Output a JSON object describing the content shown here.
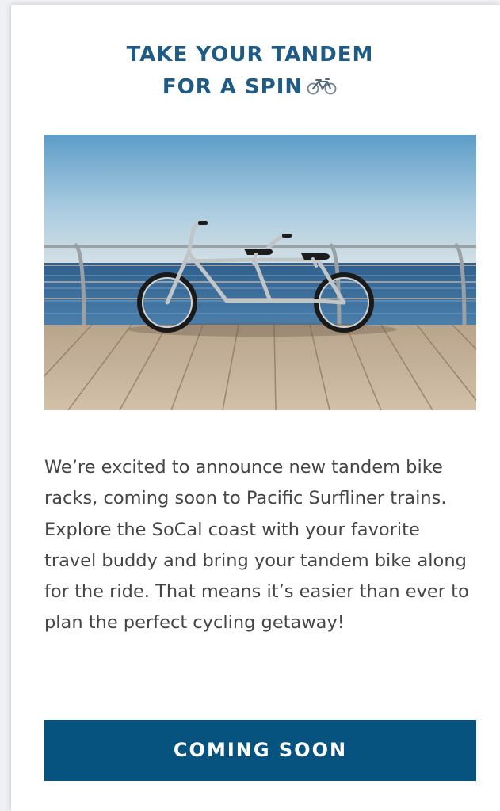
{
  "promo": {
    "title_line1": "TAKE YOUR TANDEM",
    "title_line2": "FOR A SPIN",
    "title_icon": "bicycle-icon",
    "image_subject": "tandem-bicycle-on-boardwalk",
    "body": "We’re excited to announce new tandem bike racks, coming soon to Pacific Surfliner trains. Explore the SoCal coast with your favorite travel buddy and bring your tandem bike along for the ride. That means it’s easier than ever to plan the perfect cycling getaway!",
    "cta_label": "COMING SOON"
  },
  "colors": {
    "title": "#1e5b86",
    "text": "#454545",
    "button": "#05537e",
    "button_text": "#ffffff",
    "background": "#ffffff"
  }
}
